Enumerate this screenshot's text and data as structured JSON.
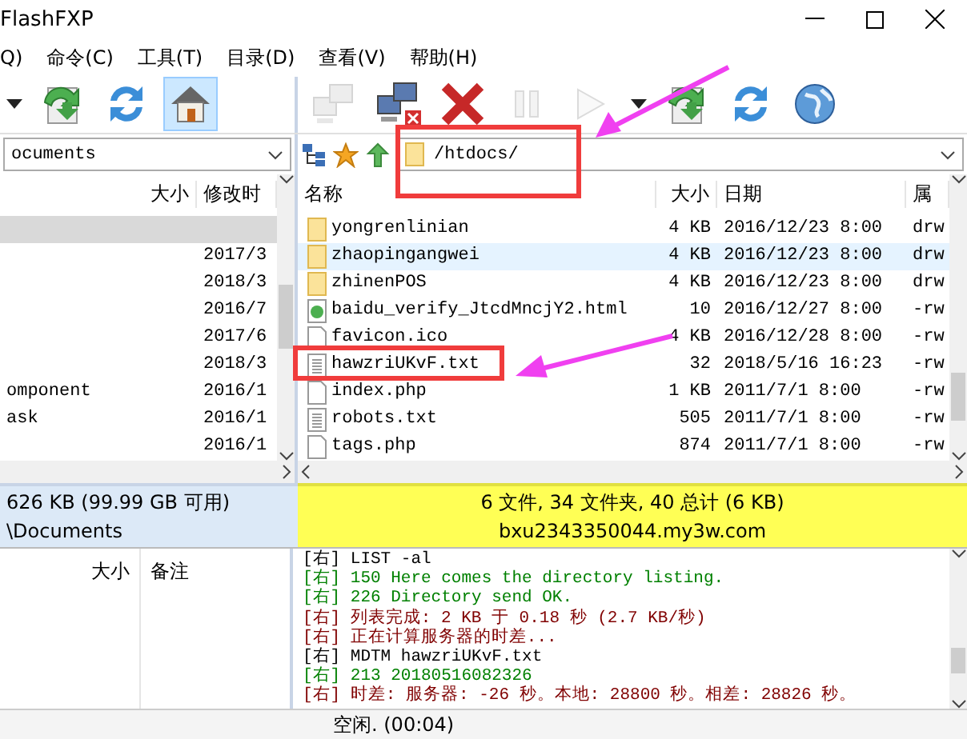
{
  "window": {
    "title": "FlashFXP"
  },
  "menu": [
    {
      "label": "Q)"
    },
    {
      "label": "命令(C)"
    },
    {
      "label": "工具(T)"
    },
    {
      "label": "目录(D)"
    },
    {
      "label": "查看(V)"
    },
    {
      "label": "帮助(H)"
    }
  ],
  "left_toolbar": [
    {
      "kind": "caret",
      "selected": false,
      "disabled": false
    },
    {
      "kind": "transfer",
      "selected": false,
      "disabled": false
    },
    {
      "kind": "refresh",
      "selected": false,
      "disabled": false
    },
    {
      "kind": "home",
      "selected": true,
      "disabled": false
    }
  ],
  "right_toolbar": [
    {
      "kind": "connect",
      "selected": false,
      "disabled": true
    },
    {
      "kind": "disconnect",
      "selected": false,
      "disabled": false
    },
    {
      "kind": "abort",
      "selected": false,
      "disabled": false
    },
    {
      "kind": "pause",
      "selected": false,
      "disabled": true
    },
    {
      "kind": "play",
      "selected": false,
      "disabled": true
    },
    {
      "kind": "caret",
      "selected": false,
      "disabled": false
    },
    {
      "kind": "transfer",
      "selected": false,
      "disabled": false
    },
    {
      "kind": "refresh",
      "selected": false,
      "disabled": false
    },
    {
      "kind": "globe",
      "selected": false,
      "disabled": false
    }
  ],
  "left_pane": {
    "path": "ocuments",
    "columns": [
      "大小",
      "修改时"
    ],
    "rows": [
      {
        "selected": true
      },
      {
        "date": "2017/3",
        "selected": false
      },
      {
        "date": "2018/3",
        "selected": false
      },
      {
        "date": "2016/7",
        "selected": false
      },
      {
        "date": "2017/6",
        "selected": false
      },
      {
        "date": "2018/3",
        "selected": false
      },
      {
        "name": "omponent",
        "date": "2016/1",
        "selected": false
      },
      {
        "name": "ask",
        "date": "2016/1",
        "selected": false
      },
      {
        "date": "2016/1",
        "selected": false
      }
    ],
    "status": [
      "626 KB (99.99 GB 可用)",
      "\\Documents"
    ]
  },
  "right_pane": {
    "path": "/htdocs/",
    "columns": [
      "名称",
      "大小",
      "日期",
      "属"
    ],
    "files": [
      {
        "kind": "folder",
        "name": "yongrenlinian",
        "size": "4 KB",
        "date": "2016/12/23 8:00",
        "attrs": "drw",
        "selected": false
      },
      {
        "kind": "folder",
        "name": "zhaopingangwei",
        "size": "4 KB",
        "date": "2016/12/23 8:00",
        "attrs": "drw",
        "selected": true
      },
      {
        "kind": "folder",
        "name": "zhinenPOS",
        "size": "4 KB",
        "date": "2016/12/23 8:00",
        "attrs": "drw",
        "selected": false
      },
      {
        "kind": "html",
        "name": "baidu_verify_JtcdMncjY2.html",
        "size": "10",
        "date": "2016/12/27 8:00",
        "attrs": "-rw",
        "selected": false
      },
      {
        "kind": "file",
        "name": "favicon.ico",
        "size": "4 KB",
        "date": "2016/12/28 8:00",
        "attrs": "-rw",
        "selected": false
      },
      {
        "kind": "text",
        "name": "hawzriUKvF.txt",
        "size": "32",
        "date": "2018/5/16 16:23",
        "attrs": "-rw",
        "selected": false
      },
      {
        "kind": "file",
        "name": "index.php",
        "size": "1 KB",
        "date": "2011/7/1 8:00",
        "attrs": "-rw",
        "selected": false
      },
      {
        "kind": "text",
        "name": "robots.txt",
        "size": "505",
        "date": "2011/7/1 8:00",
        "attrs": "-rw",
        "selected": false
      },
      {
        "kind": "file",
        "name": "tags.php",
        "size": "874",
        "date": "2011/7/1 8:00",
        "attrs": "-rw",
        "selected": false
      }
    ],
    "status": [
      "6 文件, 34 文件夹, 40 总计 (6 KB)",
      "bxu2343350044.my3w.com"
    ]
  },
  "queue": {
    "columns": [
      "大小",
      "备注"
    ]
  },
  "log": [
    {
      "text": "[右] LIST -al",
      "color": "#000000"
    },
    {
      "text": "[右] 150 Here comes the directory listing.",
      "color": "#008000"
    },
    {
      "text": "[右] 226 Directory send OK.",
      "color": "#008000"
    },
    {
      "text": "[右] 列表完成: 2 KB 于 0.18 秒 (2.7 KB/秒)",
      "color": "#800000"
    },
    {
      "text": "[右] 正在计算服务器的时差...",
      "color": "#800000"
    },
    {
      "text": "[右] MDTM hawzriUKvF.txt",
      "color": "#000000"
    },
    {
      "text": "[右] 213 20180516082326",
      "color": "#008000"
    },
    {
      "text": "[右] 时差: 服务器: -26 秒。本地: 28800 秒。相差: 28826 秒。",
      "color": "#800000"
    }
  ],
  "status_bar": {
    "text": "空闲. (00:04)"
  }
}
